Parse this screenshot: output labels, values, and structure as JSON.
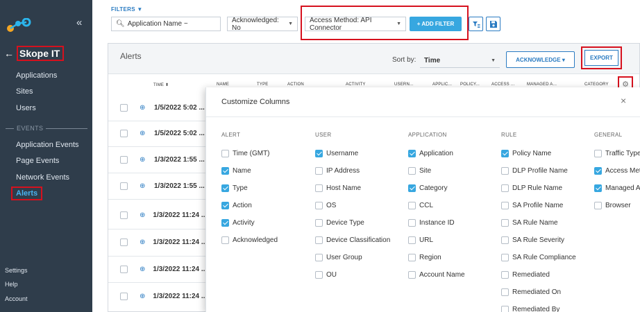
{
  "sidebar": {
    "collapse_icon": "«",
    "back_icon": "←",
    "title": "Skope IT",
    "nav": [
      {
        "label": "Applications"
      },
      {
        "label": "Sites"
      },
      {
        "label": "Users"
      }
    ],
    "events_header": "EVENTS",
    "events": [
      {
        "label": "Application Events"
      },
      {
        "label": "Page Events"
      },
      {
        "label": "Network Events"
      }
    ],
    "active_item": "Alerts",
    "footer": [
      "Settings",
      "Help",
      "Account"
    ]
  },
  "filters": {
    "label": "FILTERS ▼",
    "search_placeholder": "Application Name ~",
    "acknowledged": "Acknowledged: No",
    "access_method": "Access Method: API Connector",
    "add_filter": "+ ADD FILTER"
  },
  "panel": {
    "title": "Alerts",
    "sort_by_label": "Sort by:",
    "sort_value": "Time",
    "acknowledge_btn": "ACKNOWLEDGE ▾",
    "export_btn": "EXPORT",
    "columns": [
      "TIME ⬍",
      "NAME",
      "TYPE",
      "ACTION",
      "ACTIVITY",
      "USERN...",
      "APPLIC...",
      "POLICY...",
      "ACCESS ...",
      "MANAGED A...",
      "CATEGORY"
    ],
    "rows": [
      {
        "time": "1/5/2022 5:02 ..."
      },
      {
        "time": "1/5/2022 5:02 ..."
      },
      {
        "time": "1/3/2022 1:55 ..."
      },
      {
        "time": "1/3/2022 1:55 ..."
      },
      {
        "time": "1/3/2022 11:24 ..."
      },
      {
        "time": "1/3/2022 11:24 ..."
      },
      {
        "time": "1/3/2022 11:24 ..."
      },
      {
        "time": "1/3/2022 11:24 ..."
      }
    ]
  },
  "modal": {
    "title": "Customize Columns",
    "close": "×",
    "groups": [
      {
        "header": "ALERT",
        "options": [
          {
            "label": "Time (GMT)",
            "checked": false
          },
          {
            "label": "Name",
            "checked": true
          },
          {
            "label": "Type",
            "checked": true
          },
          {
            "label": "Action",
            "checked": true
          },
          {
            "label": "Activity",
            "checked": true
          },
          {
            "label": "Acknowledged",
            "checked": false
          }
        ]
      },
      {
        "header": "USER",
        "options": [
          {
            "label": "Username",
            "checked": true
          },
          {
            "label": "IP Address",
            "checked": false
          },
          {
            "label": "Host Name",
            "checked": false
          },
          {
            "label": "OS",
            "checked": false
          },
          {
            "label": "Device Type",
            "checked": false
          },
          {
            "label": "Device Classification",
            "checked": false
          },
          {
            "label": "User Group",
            "checked": false
          },
          {
            "label": "OU",
            "checked": false
          }
        ]
      },
      {
        "header": "APPLICATION",
        "options": [
          {
            "label": "Application",
            "checked": true
          },
          {
            "label": "Site",
            "checked": false
          },
          {
            "label": "Category",
            "checked": true
          },
          {
            "label": "CCL",
            "checked": false
          },
          {
            "label": "Instance ID",
            "checked": false
          },
          {
            "label": "URL",
            "checked": false
          },
          {
            "label": "Region",
            "checked": false
          },
          {
            "label": "Account Name",
            "checked": false
          }
        ]
      },
      {
        "header": "RULE",
        "options": [
          {
            "label": "Policy Name",
            "checked": true
          },
          {
            "label": "DLP Profile Name",
            "checked": false
          },
          {
            "label": "DLP Rule Name",
            "checked": false
          },
          {
            "label": "SA Profile Name",
            "checked": false
          },
          {
            "label": "SA Rule Name",
            "checked": false
          },
          {
            "label": "SA Rule Severity",
            "checked": false
          },
          {
            "label": "SA Rule Compliance",
            "checked": false
          },
          {
            "label": "Remediated",
            "checked": false
          },
          {
            "label": "Remediated On",
            "checked": false
          },
          {
            "label": "Remediated By",
            "checked": false
          }
        ]
      },
      {
        "header": "GENERAL",
        "options": [
          {
            "label": "Traffic Type",
            "checked": false
          },
          {
            "label": "Access Method",
            "checked": true
          },
          {
            "label": "Managed App",
            "checked": true
          },
          {
            "label": "Browser",
            "checked": false
          }
        ]
      }
    ]
  },
  "colors": {
    "sidebar_bg": "#2f3d4b",
    "accent_blue": "#37a7e0",
    "link_blue": "#2a7bc2",
    "highlight_red": "#d6111e"
  }
}
